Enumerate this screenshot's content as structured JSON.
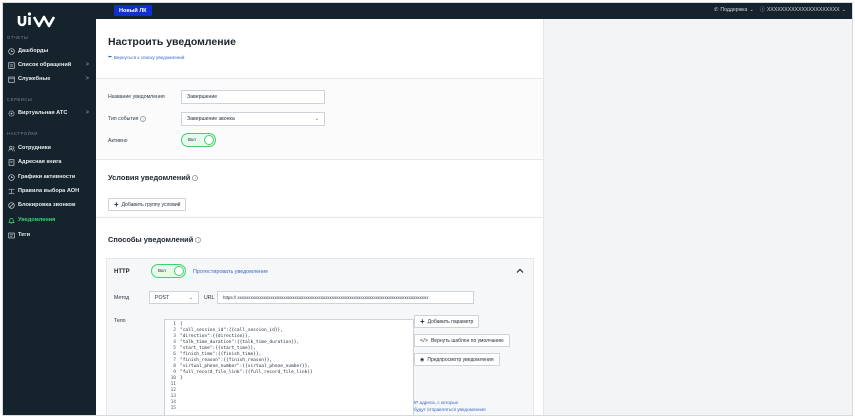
{
  "topbar": {
    "new_lk": "Новый ЛК",
    "support": "Поддержка",
    "account": "XXXXXXXXXXXXXXXXXXXXX"
  },
  "sidebar": {
    "logo_text": "uiw",
    "sections": [
      {
        "title": "ОТЧЕТЫ"
      },
      {
        "title": "СЕРВИСЫ"
      },
      {
        "title": "НАСТРОЙКИ"
      }
    ],
    "items": [
      {
        "label": "Дашборды",
        "icon": "clock-icon",
        "chevron": false,
        "active": false
      },
      {
        "label": "Список обращений",
        "icon": "list-icon",
        "chevron": true,
        "active": false
      },
      {
        "label": "Служебные",
        "icon": "calendar-icon",
        "chevron": true,
        "active": false
      },
      {
        "label": "Виртуальная АТС",
        "icon": "gear-icon",
        "chevron": true,
        "active": false
      },
      {
        "label": "Сотрудники",
        "icon": "users-icon",
        "chevron": false,
        "active": false
      },
      {
        "label": "Адресная книга",
        "icon": "book-icon",
        "chevron": false,
        "active": false
      },
      {
        "label": "Графики активности",
        "icon": "clock-icon",
        "chevron": false,
        "active": false
      },
      {
        "label": "Правила выбора АОН",
        "icon": "rules-icon",
        "chevron": false,
        "active": false
      },
      {
        "label": "Блокировка звонков",
        "icon": "block-icon",
        "chevron": false,
        "active": false
      },
      {
        "label": "Уведомления",
        "icon": "bell-icon",
        "chevron": false,
        "active": true
      },
      {
        "label": "Теги",
        "icon": "tag-icon",
        "chevron": false,
        "active": false
      }
    ]
  },
  "header": {
    "title": "Настроить уведомление",
    "back_link": "Вернуться к списку уведомлений"
  },
  "form": {
    "name_label": "Название уведомления",
    "name_value": "Завершение",
    "event_label": "Тип события",
    "event_value": "Завершение звонка",
    "active_label": "Активно",
    "active_toggle": "Вкл"
  },
  "conditions": {
    "title": "Условия уведомлений",
    "add_group": "Добавить группу условий"
  },
  "methods": {
    "title": "Способы уведомлений",
    "http_label": "HTTP",
    "http_toggle": "Вкл",
    "test_link": "Протестировать уведомление",
    "method_label": "Метод",
    "method_value": "POST",
    "url_label": "URL",
    "url_value": "https:// xxxxxxxxxxxxxxxxxxxxxxxxxxxxxxxxxxxxxxxxxxxxxxxxxxxxxxxxxxxxxxxxxxxxxxxxxxxxxxxxxxxxxxx",
    "body_label": "Тело",
    "code_lines": [
      "{",
      "\"call_session_id\":{{call_session_id}},",
      "\"direction\":{{direction}},",
      "\"talk_time_duration\":{{talk_time_duration}},",
      "\"start_time\":{{start_time}},",
      "\"finish_time\":{{finish_time}},",
      "\"finish_reason\":{{finish_reason}},",
      "\"virtual_phone_number\":{{virtual_phone_number}},",
      "\"full_record_file_link\":{{full_record_file_link}}",
      "}",
      "",
      "",
      "",
      "",
      ""
    ],
    "add_param": "Добавить параметр",
    "reset_template": "Вернуть шаблон по умолчанию",
    "preview": "Предпросмотр уведомления",
    "ip_hint_1": "IP адреса, с которых",
    "ip_hint_2": "будут отправляться уведомления"
  }
}
